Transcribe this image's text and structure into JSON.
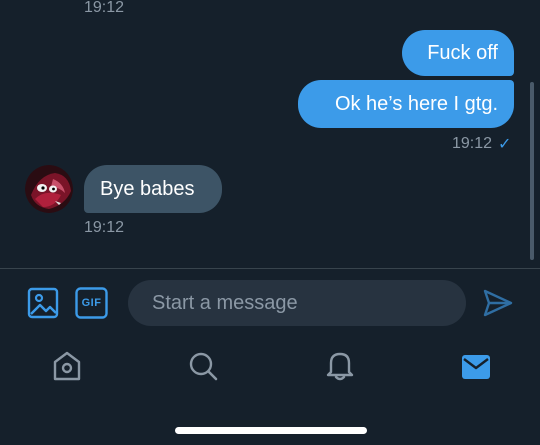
{
  "conversation": {
    "top_time": "19:12",
    "messages": [
      {
        "direction": "sent",
        "text": "Fuck off"
      },
      {
        "direction": "sent",
        "text": "Ok he’s here I gtg."
      },
      {
        "direction": "sent_meta",
        "time": "19:12",
        "status": "✓"
      },
      {
        "direction": "received",
        "text": "Bye babes"
      },
      {
        "direction": "received_meta",
        "time": "19:12"
      }
    ]
  },
  "composer": {
    "placeholder": "Start a message",
    "gif_label": "GIF"
  },
  "colors": {
    "background": "#15202b",
    "sent_bubble": "#3c9be9",
    "received_bubble": "#3d5466",
    "accent": "#3c9be9",
    "muted": "#8b98a5"
  },
  "tabbar": {
    "items": [
      "home-icon",
      "search-icon",
      "bell-icon",
      "mail-icon"
    ],
    "active": "mail-icon"
  }
}
